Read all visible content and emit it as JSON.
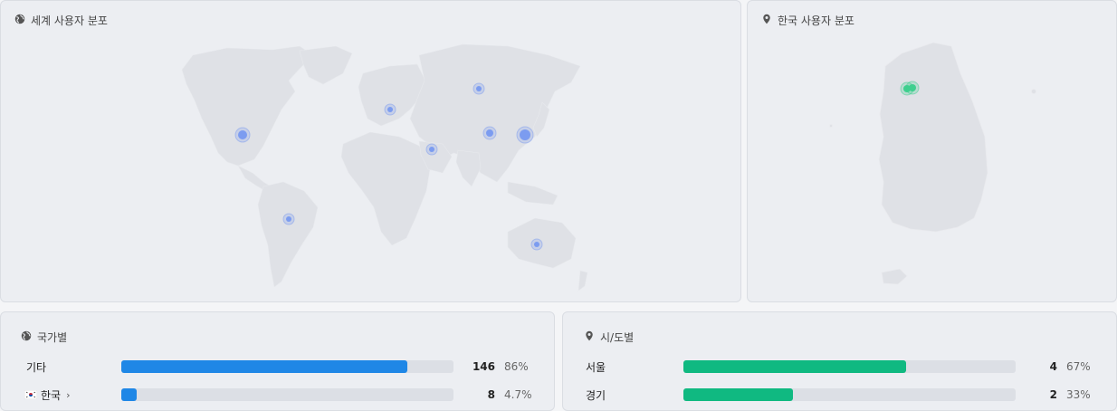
{
  "world_map": {
    "title": "세계 사용자 분포",
    "title_icon": "globe-icon",
    "dot_color": "#7c9cf0"
  },
  "korea_map": {
    "title": "한국 사용자 분포",
    "title_icon": "map-pin-icon",
    "dot_color": "#3ecf8e"
  },
  "country_panel": {
    "title": "국가별",
    "title_icon": "globe-icon",
    "bar_color": "#1f87e6",
    "rows": [
      {
        "label": "기타",
        "count": "146",
        "pct": "86%",
        "fraction": 0.86,
        "flag": "",
        "has_chevron": false
      },
      {
        "label": "한국",
        "count": "8",
        "pct": "4.7%",
        "fraction": 0.047,
        "flag": "kr-flag-icon",
        "has_chevron": true,
        "chevron": "›"
      }
    ]
  },
  "region_panel": {
    "title": "시/도별",
    "title_icon": "map-pin-icon",
    "bar_color": "#10b981",
    "rows": [
      {
        "label": "서울",
        "count": "4",
        "pct": "67%",
        "fraction": 0.67
      },
      {
        "label": "경기",
        "count": "2",
        "pct": "33%",
        "fraction": 0.33
      }
    ]
  }
}
